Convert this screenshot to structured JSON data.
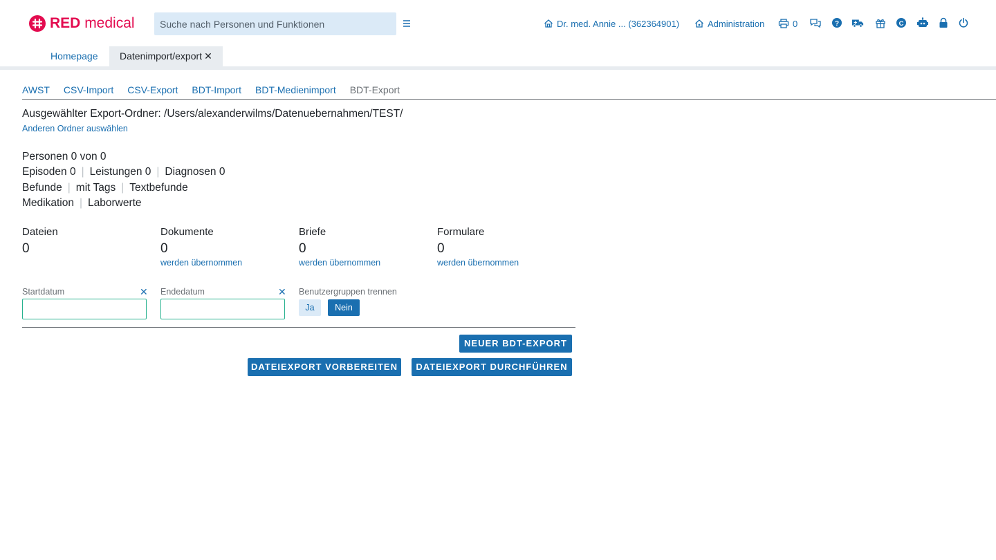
{
  "brand": {
    "bold": "RED",
    "light": "medical",
    "color": "#e30b4f"
  },
  "search": {
    "placeholder": "Suche nach Personen und Funktionen"
  },
  "header": {
    "user_label": "Dr. med. Annie ... (362364901)",
    "admin_label": "Administration",
    "print_count": "0"
  },
  "tabs": [
    {
      "label": "Homepage"
    },
    {
      "label": "Datenimport/export",
      "close": "✕"
    }
  ],
  "subnav": [
    {
      "label": "AWST"
    },
    {
      "label": "CSV-Import"
    },
    {
      "label": "CSV-Export"
    },
    {
      "label": "BDT-Import"
    },
    {
      "label": "BDT-Medienimport"
    },
    {
      "label": "BDT-Export"
    }
  ],
  "folder": {
    "text": "Ausgewählter Export-Ordner: /Users/alexanderwilms/Datenuebernahmen/TEST/",
    "change_link": "Anderen Ordner auswählen"
  },
  "summary": {
    "persons": "Personen 0 von 0",
    "episodes": "Episoden 0",
    "services": "Leistungen 0",
    "diagnoses": "Diagnosen 0",
    "findings": "Befunde",
    "with_tags": "mit Tags",
    "text_findings": "Textbefunde",
    "medication": "Medikation",
    "lab_values": "Laborwerte",
    "separator": "|"
  },
  "stats": [
    {
      "label": "Dateien",
      "value": "0",
      "link": ""
    },
    {
      "label": "Dokumente",
      "value": "0",
      "link": "werden übernommen"
    },
    {
      "label": "Briefe",
      "value": "0",
      "link": "werden übernommen"
    },
    {
      "label": "Formulare",
      "value": "0",
      "link": "werden übernommen"
    }
  ],
  "filters": {
    "start_label": "Startdatum",
    "end_label": "Endedatum",
    "clear": "✕",
    "start_value": "",
    "end_value": "",
    "usergroups_label": "Benutzergruppen trennen",
    "yes": "Ja",
    "no": "Nein",
    "selected": "Nein"
  },
  "buttons": {
    "new_export": "NEUER BDT-EXPORT",
    "prepare": "DATEIEXPORT VORBEREITEN",
    "execute": "DATEIEXPORT DURCHFÜHREN"
  },
  "colors": {
    "accent": "#1a6fb0",
    "brand": "#e30b4f",
    "input_border": "#28b28f",
    "search_bg": "#dbeaf7"
  }
}
